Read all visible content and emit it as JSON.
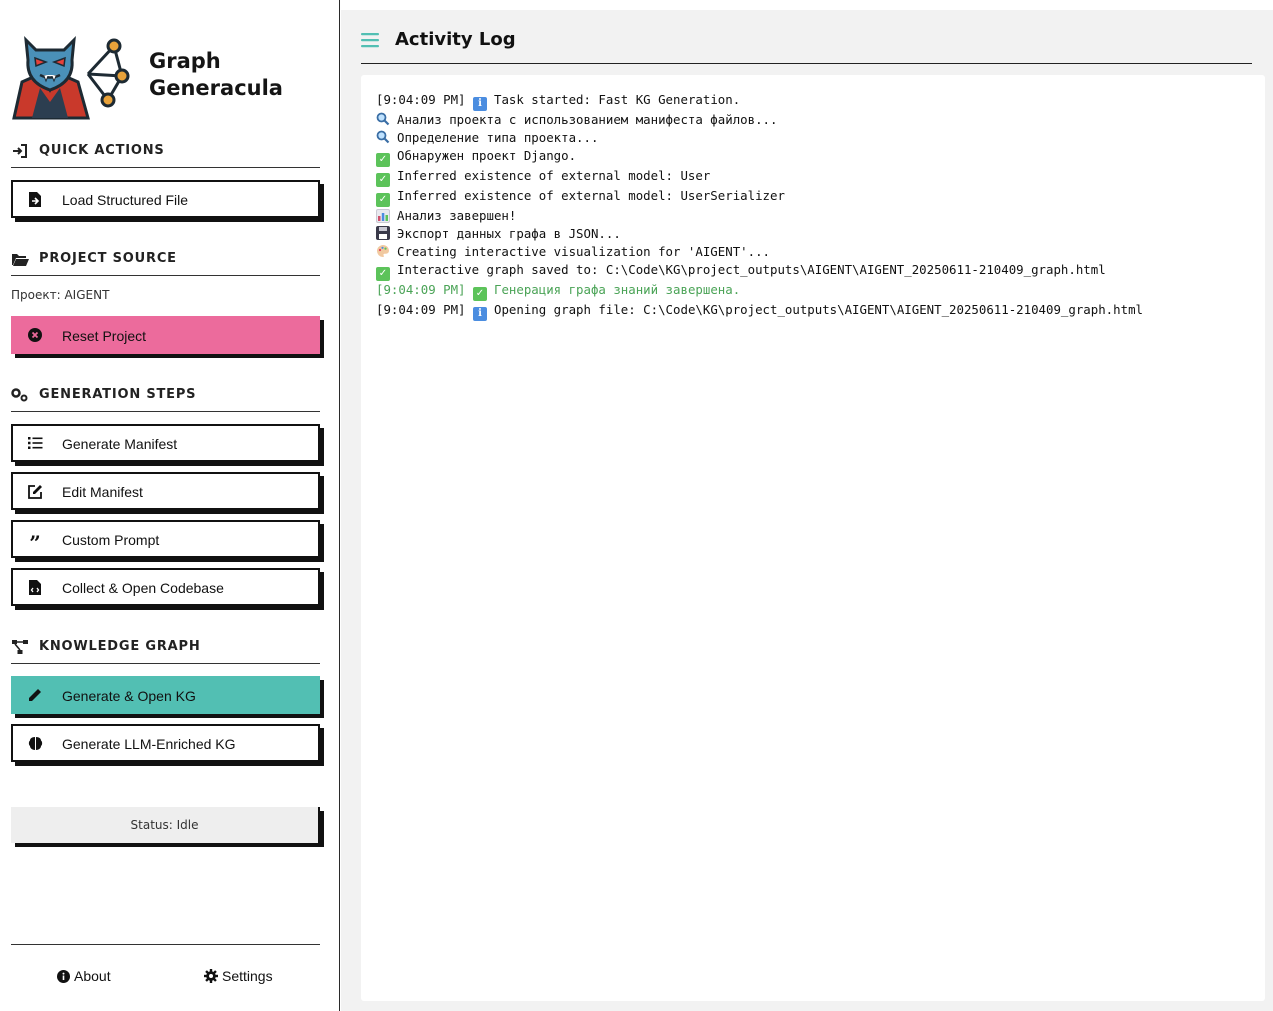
{
  "app": {
    "name": "Graph Generacula",
    "name_line1": "Graph",
    "name_line2": "Generacula"
  },
  "sidebar": {
    "quick_actions": {
      "heading": "QUICK ACTIONS",
      "load_file": "Load Structured File"
    },
    "project_source": {
      "heading": "PROJECT SOURCE",
      "project_label": "Проект: AIGENT",
      "reset": "Reset Project"
    },
    "generation_steps": {
      "heading": "GENERATION STEPS",
      "generate_manifest": "Generate Manifest",
      "edit_manifest": "Edit Manifest",
      "custom_prompt": "Custom Prompt",
      "collect_open": "Collect & Open Codebase"
    },
    "knowledge_graph": {
      "heading": "KNOWLEDGE GRAPH",
      "generate_open_kg": "Generate & Open KG",
      "generate_llm_kg": "Generate LLM-Enriched KG"
    },
    "status": "Status: Idle",
    "footer": {
      "about": "About",
      "settings": "Settings"
    }
  },
  "main": {
    "title": "Activity Log",
    "log": [
      {
        "prefix": "[9:04:09 PM] ",
        "icon": "info-icon",
        "text": "Task started: Fast KG Generation."
      },
      {
        "prefix": "",
        "icon": "magnifier-icon",
        "text": "Анализ проекта с использованием манифеста файлов..."
      },
      {
        "prefix": "",
        "icon": "magnifier-icon",
        "text": "Определение типа проекта..."
      },
      {
        "prefix": "",
        "icon": "check-icon",
        "text": "Обнаружен проект Django."
      },
      {
        "prefix": "",
        "icon": "check-icon",
        "text": "Inferred existence of external model: User"
      },
      {
        "prefix": "",
        "icon": "check-icon",
        "text": "Inferred existence of external model: UserSerializer"
      },
      {
        "prefix": "",
        "icon": "chart-icon",
        "text": "Анализ завершен!"
      },
      {
        "prefix": "",
        "icon": "floppy-icon",
        "text": "Экспорт данных графа в JSON..."
      },
      {
        "prefix": "",
        "icon": "palette-icon",
        "text": "Creating interactive visualization for 'AIGENT'..."
      },
      {
        "prefix": "",
        "icon": "check-icon",
        "text": "Interactive graph saved to: C:\\Code\\KG\\project_outputs\\AIGENT\\AIGENT_20250611-210409_graph.html"
      },
      {
        "prefix": "[9:04:09 PM] ",
        "icon": "check-icon",
        "text": "Генерация графа знаний завершена.",
        "style": "green"
      },
      {
        "prefix": "[9:04:09 PM] ",
        "icon": "info-icon",
        "text": "Opening graph file: C:\\Code\\KG\\project_outputs\\AIGENT\\AIGENT_20250611-210409_graph.html"
      }
    ]
  },
  "colors": {
    "accent_teal": "#52bfb3",
    "reset_pink": "#ec6b9c",
    "success_green": "#4aa356"
  }
}
